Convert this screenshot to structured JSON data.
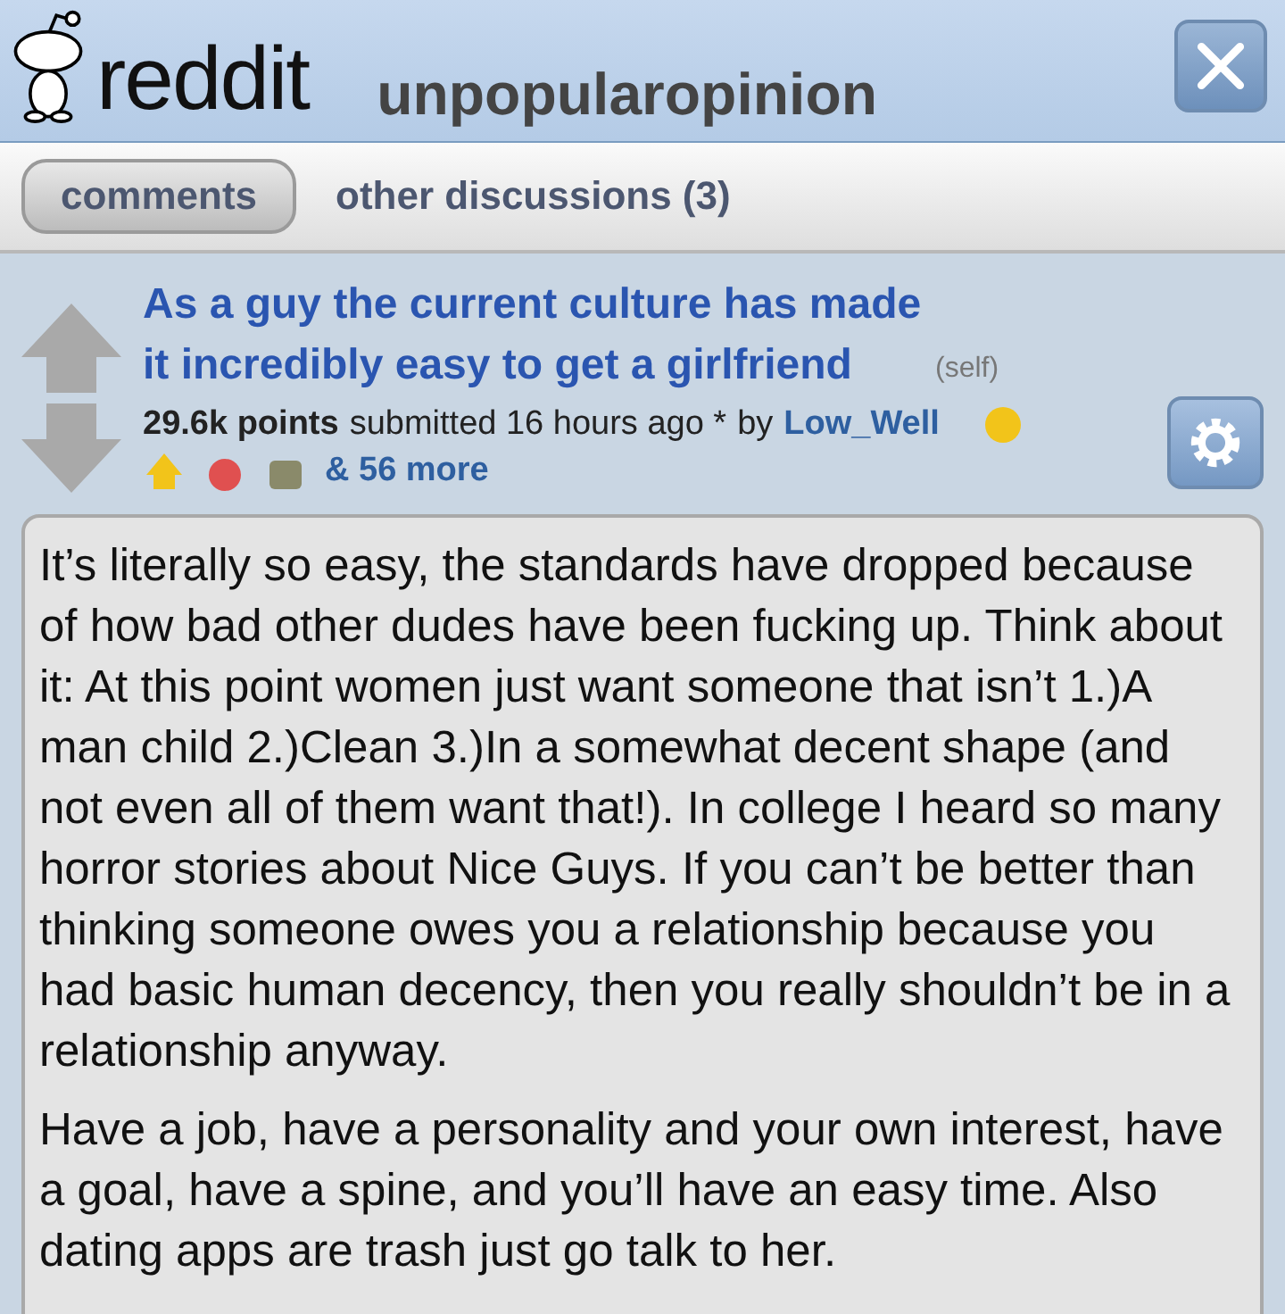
{
  "header": {
    "logo_text": "reddit",
    "subreddit": "unpopularopinion"
  },
  "tabs": [
    {
      "label": "comments",
      "selected": true
    },
    {
      "label": "other discussions (3)",
      "selected": false
    }
  ],
  "post": {
    "title": "As a guy the current culture has made it incredibly easy to get a girlfriend",
    "domain": "(self)",
    "points": "29.6k points",
    "submitted": "submitted 16 hours ago *",
    "by": "by",
    "author": "Low_Well",
    "more_awards": "& 56 more",
    "body": [
      "It’s literally so easy, the standards have dropped because of how bad other dudes have been fucking up. Think about it: At this point women just want someone that isn’t 1.)A man child 2.)Clean 3.)In a somewhat decent shape (and not even all of them want that!). In college I heard so many horror stories about Nice Guys. If you can’t be better than thinking someone owes you a relationship because you had basic human decency, then you really shouldn’t be in a relationship anyway.",
      "Have a job, have a personality and your own interest, have a goal, have a spine, and you’ll have an easy time. Also dating apps are trash just go talk to her."
    ]
  }
}
